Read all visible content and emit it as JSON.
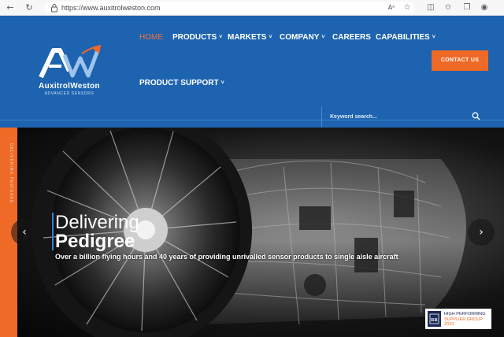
{
  "browser": {
    "url": "https://www.auxitrolweston.com",
    "reader_label": "Aᵃ"
  },
  "logo": {
    "wordmark": "AuxitrolWeston",
    "tagline": "ADVANCED SENSORS"
  },
  "nav": {
    "items": [
      {
        "label": "HOME",
        "active": true
      },
      {
        "label": "PRODUCTS",
        "dropdown": true
      },
      {
        "label": "MARKETS",
        "dropdown": true
      },
      {
        "label": "COMPANY",
        "dropdown": true
      },
      {
        "label": "CAREERS"
      },
      {
        "label": "CAPABILITIES",
        "dropdown": true
      },
      {
        "label": "PRODUCT SUPPORT",
        "dropdown": true
      }
    ],
    "caret": "˅"
  },
  "contact": {
    "label": "CONTACT US"
  },
  "search": {
    "placeholder": "Keyword search..."
  },
  "side_strip": {
    "text": "Delivering Pedigree"
  },
  "hero": {
    "title_line1": "Delivering",
    "title_line2": "Pedigree",
    "caption": "Over a billion flying hours and 40 years of providing unrivalled sensor products to single aisle aircraft",
    "prev_arrow": "‹",
    "next_arrow": "›"
  },
  "badge": {
    "line1": "HIGH PERFORMING",
    "line2": "SUPPLIER GROUP 2023"
  },
  "colors": {
    "header_blue": "#1d63b0",
    "accent_orange": "#ef6a26",
    "active_nav": "#f0733a"
  }
}
